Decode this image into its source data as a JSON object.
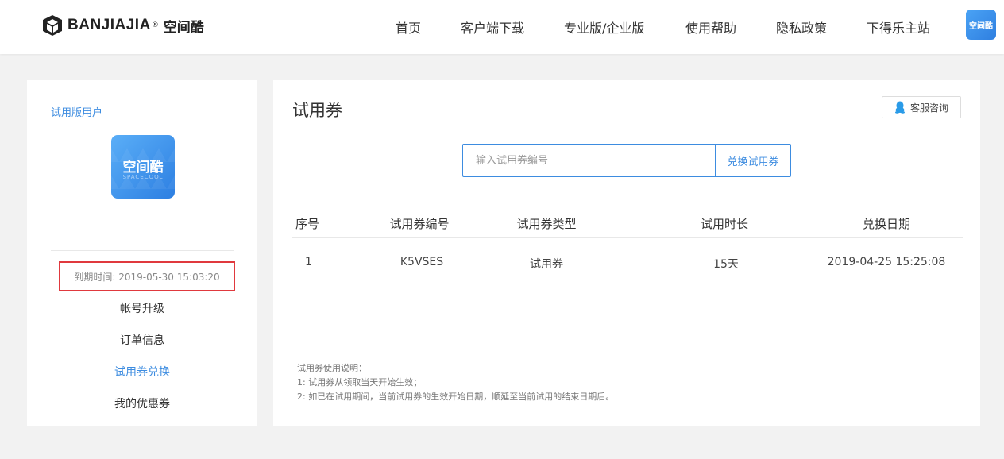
{
  "header": {
    "logo_text": "BANJIAJIA",
    "logo_reg": "®",
    "logo_cn": "空间酷",
    "nav": [
      {
        "label": "首页"
      },
      {
        "label": "客户端下载"
      },
      {
        "label": "专业版/企业版"
      },
      {
        "label": "使用帮助"
      },
      {
        "label": "隐私政策"
      },
      {
        "label": "下得乐主站"
      }
    ],
    "avatar_text": "空间酷"
  },
  "sidebar": {
    "user_type": "试用版用户",
    "avatar_title": "空间酷",
    "avatar_subtitle": "SPACECOOL",
    "expire_text": "到期时间: 2019-05-30 15:03:20",
    "menu": [
      {
        "label": "帐号升级"
      },
      {
        "label": "订单信息"
      },
      {
        "label": "试用券兑换"
      },
      {
        "label": "我的优惠券"
      }
    ]
  },
  "main": {
    "title": "试用券",
    "service_label": "客服咨询",
    "redeem": {
      "placeholder": "输入试用券编号",
      "button_label": "兑换试用券"
    },
    "table": {
      "headers": [
        "序号",
        "试用券编号",
        "试用券类型",
        "试用时长",
        "兑换日期"
      ],
      "rows": [
        [
          "1",
          "K5VSES",
          "试用券",
          "15天",
          "2019-04-25 15:25:08"
        ]
      ]
    },
    "notes": {
      "title": "试用券使用说明：",
      "line1": "1: 试用券从领取当天开始生效；",
      "line2": "2: 如已在试用期间，当前试用券的生效开始日期，顺延至当前试用的结束日期后。"
    }
  },
  "colors": {
    "accent": "#3d8ce0",
    "highlight_border": "#e0393e"
  }
}
